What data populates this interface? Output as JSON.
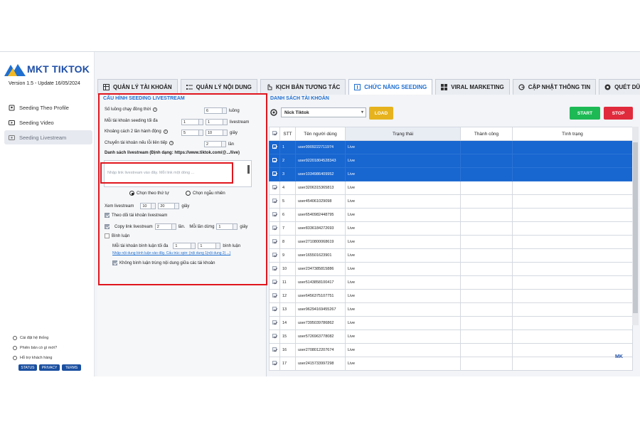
{
  "app": {
    "logo_text": "MKT TIKTOK",
    "version": "Version  1.5  - Update  16/05/2024"
  },
  "sidebar": {
    "items": [
      {
        "label": "Seeding Theo Profile",
        "icon": "person-icon"
      },
      {
        "label": "Seeding Video",
        "icon": "play-icon"
      },
      {
        "label": "Seeding Livestream",
        "icon": "live-icon"
      }
    ],
    "footer": [
      {
        "label": "Cài đặt hệ thống",
        "icon": "settings-icon"
      },
      {
        "label": "Phiên bản có gì mới?",
        "icon": "info-icon"
      },
      {
        "label": "Hỗ trợ khách hàng",
        "icon": "support-icon"
      }
    ],
    "pills": [
      "STATUS",
      "PRIVACY",
      "TERMS"
    ]
  },
  "tabs": [
    {
      "label": "QUẢN LÝ TÀI KHOẢN",
      "icon": "table-icon"
    },
    {
      "label": "QUẢN LÝ NỘI DUNG",
      "icon": "list-icon"
    },
    {
      "label": "KỊCH BẢN TƯƠNG TÁC",
      "icon": "hand-icon"
    },
    {
      "label": "CHỨC NĂNG SEEDING",
      "icon": "seed-icon"
    },
    {
      "label": "VIRAL MARKETING",
      "icon": "grid-icon"
    },
    {
      "label": "CẬP NHẬT THÔNG TIN",
      "icon": "google-icon"
    },
    {
      "label": "QUÉT DỮ LIỆU",
      "icon": "scan-icon"
    }
  ],
  "config": {
    "title": "CẤU HÌNH SEEDING LIVESTREAM",
    "threads_label": "Số luồng chạy đồng thời",
    "threads_value": "6",
    "threads_unit": "luồng",
    "max_per_account_label": "Mỗi tài khoản seeding tối đa",
    "max_per_account_from": "1",
    "max_per_account_to": "1",
    "max_per_account_unit": "livestream",
    "interval_label": "Khoảng cách 2 lần hành động",
    "interval_from": "5",
    "interval_to": "10",
    "interval_unit": "giây",
    "switch_label": "Chuyển tài khoản nếu lỗi liên tiếp",
    "switch_value": "2",
    "switch_unit": "lần",
    "list_label": "Danh sách livestream (Định dạng: https://www.tiktok.com/@.../live)",
    "list_placeholder": "Nhập link livestream vào đây. Mỗi link một dòng ...",
    "order_option": "Chọn theo thứ tự",
    "random_option": "Chọn ngẫu nhiên",
    "watch_label": "Xem livestream",
    "watch_from": "10",
    "watch_to": "20",
    "watch_unit": "giây",
    "follow_label": "Theo dõi tài khoản livestream",
    "copy_label": "Copy link livestream",
    "copy_value": "2",
    "copy_unit": "lần.",
    "each_label": "Mỗi lần dừng",
    "each_value": "1",
    "each_unit": "giây",
    "comment_label": "Bình luận",
    "comment_max_label": "Mỗi tài khoản bình luận tối đa",
    "comment_from": "1",
    "comment_to": "1",
    "comment_unit": "bình luận",
    "comment_link": "Nhập nội dung bình luận vào đây. Cấu trúc spin: {nội dung 1|nội dung 2| ...}",
    "no_dup_label": "Không bình luận trùng nội dung giữa các tài khoản"
  },
  "accounts": {
    "title": "DANH SÁCH TÀI KHOẢN",
    "select_value": "Nick Tiktok",
    "load_label": "LOAD",
    "start_label": "START",
    "stop_label": "STOP",
    "columns": [
      "STT",
      "Tên người dùng",
      "Trạng thái",
      "Thành công",
      "Tình trạng"
    ],
    "rows": [
      {
        "stt": "1",
        "user": "user9909222711974",
        "status": "Live",
        "selected": true
      },
      {
        "stt": "2",
        "user": "user92201804528343",
        "status": "Live",
        "selected": true
      },
      {
        "stt": "3",
        "user": "user1034986409952",
        "status": "Live",
        "selected": true
      },
      {
        "stt": "4",
        "user": "user3206315365813",
        "status": "Live",
        "selected": false
      },
      {
        "stt": "5",
        "user": "user454061029098",
        "status": "Live",
        "selected": false
      },
      {
        "stt": "6",
        "user": "user6540982448795",
        "status": "Live",
        "selected": false
      },
      {
        "stt": "7",
        "user": "user8336184272693",
        "status": "Live",
        "selected": false
      },
      {
        "stt": "8",
        "user": "user2710800068619",
        "status": "Live",
        "selected": false
      },
      {
        "stt": "9",
        "user": "user165501623901",
        "status": "Live",
        "selected": false
      },
      {
        "stt": "10",
        "user": "user2347385815886",
        "status": "Live",
        "selected": false
      },
      {
        "stt": "11",
        "user": "user5143858100417",
        "status": "Live",
        "selected": false
      },
      {
        "stt": "12",
        "user": "user6456375107751",
        "status": "Live",
        "selected": false
      },
      {
        "stt": "13",
        "user": "user96294169455267",
        "status": "Live",
        "selected": false
      },
      {
        "stt": "14",
        "user": "user7395039786862",
        "status": "Live",
        "selected": false
      },
      {
        "stt": "15",
        "user": "user5726963778082",
        "status": "Live",
        "selected": false
      },
      {
        "stt": "16",
        "user": "user2708012207674",
        "status": "Live",
        "selected": false
      },
      {
        "stt": "17",
        "user": "user2415733997298",
        "status": "Live",
        "selected": false
      }
    ]
  },
  "corner_logo": "MK",
  "colors": {
    "accent": "#1f6fd1",
    "highlight": "#e0161e",
    "selected_row": "#1866d0",
    "start": "#1db954",
    "stop": "#e02b3c",
    "load": "#e6b31e"
  }
}
